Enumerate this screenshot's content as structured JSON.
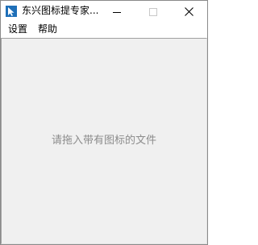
{
  "window": {
    "title": "东兴图标提专家...",
    "icon": "app-cursor-icon",
    "controls": {
      "minimize_icon": "minimize-icon",
      "maximize_icon": "maximize-icon",
      "close_icon": "close-icon"
    }
  },
  "menubar": {
    "items": [
      {
        "label": "设置"
      },
      {
        "label": "帮助"
      }
    ]
  },
  "main": {
    "drop_hint": "请拖入带有图标的文件"
  },
  "colors": {
    "client_background": "#f0f0f0",
    "hint_text": "#8c8c8c",
    "app_icon_blue": "#1f6fb8"
  }
}
